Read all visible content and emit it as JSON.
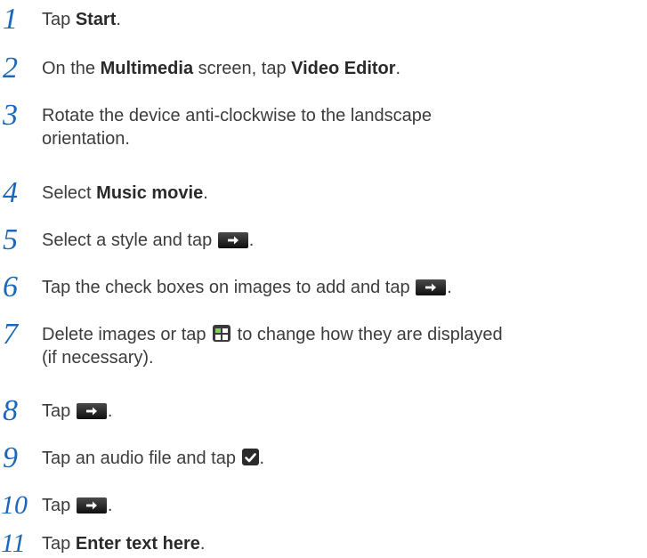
{
  "steps": [
    {
      "number": "1",
      "parts": [
        {
          "t": "Tap "
        },
        {
          "b": "Start"
        },
        {
          "t": "."
        }
      ]
    },
    {
      "number": "2",
      "parts": [
        {
          "t": "On the "
        },
        {
          "b": "Multimedia"
        },
        {
          "t": " screen, tap "
        },
        {
          "b": "Video Editor"
        },
        {
          "t": "."
        }
      ]
    },
    {
      "number": "3",
      "line1": "Rotate the device anti-clockwise to the landscape",
      "line2": "orientation."
    },
    {
      "number": "4",
      "parts": [
        {
          "t": "Select "
        },
        {
          "b": "Music movie"
        },
        {
          "t": "."
        }
      ]
    },
    {
      "number": "5",
      "before": "Select a style and tap ",
      "after": ".",
      "icon": "next-arrow-icon"
    },
    {
      "number": "6",
      "before": "Tap the check boxes on images to add and tap ",
      "after": ".",
      "icon": "next-arrow-icon"
    },
    {
      "number": "7",
      "before": "Delete images or tap ",
      "after": " to change how they are displayed",
      "line2": "(if necessary).",
      "icon": "display-mode-icon"
    },
    {
      "number": "8",
      "before": "Tap ",
      "after": ".",
      "icon": "next-arrow-icon"
    },
    {
      "number": "9",
      "before": "Tap an audio file and tap ",
      "after": ".",
      "icon": "checkmark-icon"
    },
    {
      "number": "10",
      "before": "Tap ",
      "after": ".",
      "icon": "next-arrow-icon"
    },
    {
      "number": "11",
      "parts": [
        {
          "t": "Tap "
        },
        {
          "b": "Enter text here"
        },
        {
          "t": "."
        }
      ]
    }
  ],
  "colors": {
    "step_number": "#1b67b8",
    "body_text": "#3c3c3c",
    "icon_bg": "#1a1a1a"
  }
}
